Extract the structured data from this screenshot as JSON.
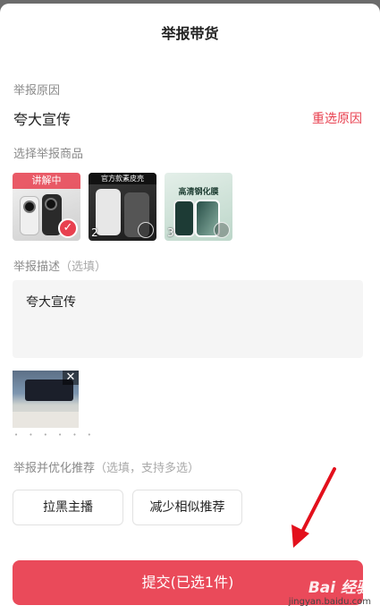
{
  "header": {
    "title": "举报带货"
  },
  "reason": {
    "section_label": "举报原因",
    "value": "夸大宣传",
    "reselect_label": "重选原因"
  },
  "products": {
    "section_label": "选择举报商品",
    "items": [
      {
        "badge": "讲解中",
        "selected": true
      },
      {
        "index": "2",
        "caption": "官方款素皮壳",
        "selected": false
      },
      {
        "index": "3",
        "caption": "高清钢化膜",
        "selected": false
      }
    ]
  },
  "description": {
    "section_label": "举报描述",
    "optional_hint": "（选填）",
    "value": "夸大宣传"
  },
  "optimize": {
    "section_label": "举报并优化推荐",
    "optional_hint": "（选填，支持多选）",
    "options": [
      "拉黑主播",
      "减少相似推荐"
    ]
  },
  "submit": {
    "label": "提交(已选1件)"
  },
  "watermark": {
    "logo": "Bai 经验",
    "url": "jingyan.baidu.com"
  },
  "colors": {
    "accent": "#ea4a5a",
    "annotation_arrow": "#e3101c"
  }
}
